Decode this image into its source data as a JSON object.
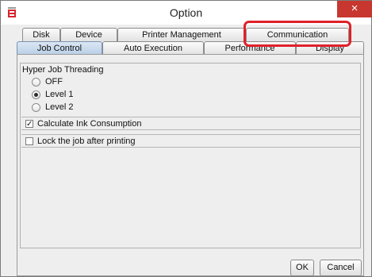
{
  "window": {
    "title": "Option",
    "close_glyph": "×"
  },
  "tabs_row1": [
    {
      "label": "Disk",
      "selected": false
    },
    {
      "label": "Device",
      "selected": false
    },
    {
      "label": "Printer Management",
      "selected": false
    },
    {
      "label": "Communication",
      "selected": false
    }
  ],
  "tabs_row2": [
    {
      "label": "Job Control",
      "selected": true
    },
    {
      "label": "Auto Execution",
      "selected": false
    },
    {
      "label": "Performance",
      "selected": false
    },
    {
      "label": "Display",
      "selected": false
    }
  ],
  "job_control": {
    "threading": {
      "title": "Hyper Job Threading",
      "options": [
        {
          "label": "OFF",
          "selected": false
        },
        {
          "label": "Level 1",
          "selected": true
        },
        {
          "label": "Level 2",
          "selected": false
        }
      ]
    },
    "calculate_ink": {
      "label": "Calculate Ink Consumption",
      "checked": true
    },
    "lock_job": {
      "label": "Lock the job after printing",
      "checked": false
    }
  },
  "buttons": {
    "ok": "OK",
    "cancel": "Cancel"
  },
  "colors": {
    "highlight": "#e0202a",
    "close": "#c7372f",
    "selected_tab": "#b8cfe6"
  }
}
